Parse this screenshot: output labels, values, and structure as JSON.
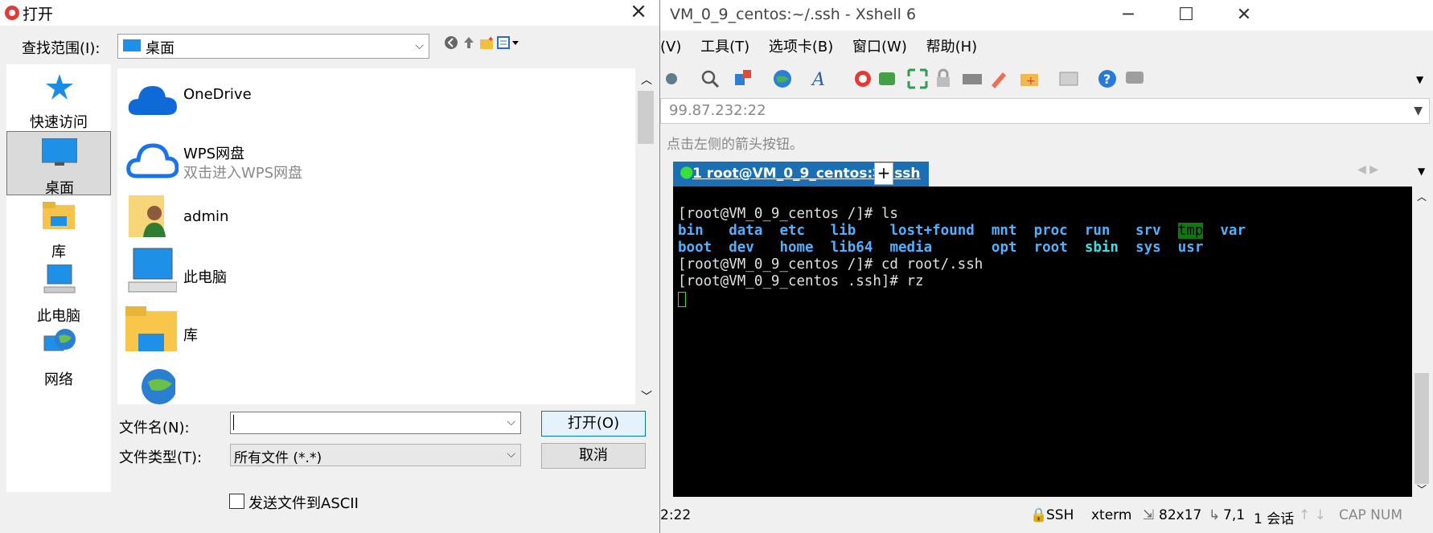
{
  "xshell": {
    "title": "VM_0_9_centos:~/.ssh - Xshell 6",
    "menu": [
      "(V)",
      "工具(T)",
      "选项卡(B)",
      "窗口(W)",
      "帮助(H)"
    ],
    "address": "99.87.232:22",
    "hint": "点击左侧的箭头按钮。",
    "tab_label": "1 root@VM_0_9_centos:~/.ssh",
    "tab_close": "×",
    "tab_add": "+",
    "terminal": {
      "line1": "[root@VM_0_9_centos /]# ls",
      "ls_row1": [
        "bin",
        "data",
        "etc",
        "lib",
        "lost+found",
        "mnt",
        "proc",
        "run",
        "srv",
        "tmp",
        "var"
      ],
      "ls_row2": [
        "boot",
        "dev",
        "home",
        "lib64",
        "media",
        "opt",
        "root",
        "sbin",
        "sys",
        "usr"
      ],
      "line4": "[root@VM_0_9_centos /]# cd root/.ssh",
      "line5": "[root@VM_0_9_centos .ssh]# rz"
    },
    "status": {
      "left": "2:22",
      "protocol": "SSH",
      "term": "xterm",
      "size": "82x17",
      "pos": "7,1",
      "sessions": "1 会话",
      "caps": "CAP NUM"
    }
  },
  "dialog": {
    "title": "打开",
    "close": "×",
    "lookin_label": "查找范围(I):",
    "lookin_value": "桌面",
    "places": [
      {
        "label": "快速访问",
        "icon": "star-icon"
      },
      {
        "label": "桌面",
        "icon": "desktop-icon"
      },
      {
        "label": "库",
        "icon": "library-icon"
      },
      {
        "label": "此电脑",
        "icon": "computer-icon"
      },
      {
        "label": "网络",
        "icon": "network-icon"
      }
    ],
    "files": [
      {
        "name": "OneDrive",
        "sub": ""
      },
      {
        "name": "WPS网盘",
        "sub": "双击进入WPS网盘"
      },
      {
        "name": "admin",
        "sub": ""
      },
      {
        "name": "此电脑",
        "sub": ""
      },
      {
        "name": "库",
        "sub": ""
      }
    ],
    "filename_label": "文件名(N):",
    "filename_value": "",
    "filetype_label": "文件类型(T):",
    "filetype_value": "所有文件 (*.*)",
    "open_button": "打开(O)",
    "cancel_button": "取消",
    "ascii_checkbox": "发送文件到ASCII"
  }
}
